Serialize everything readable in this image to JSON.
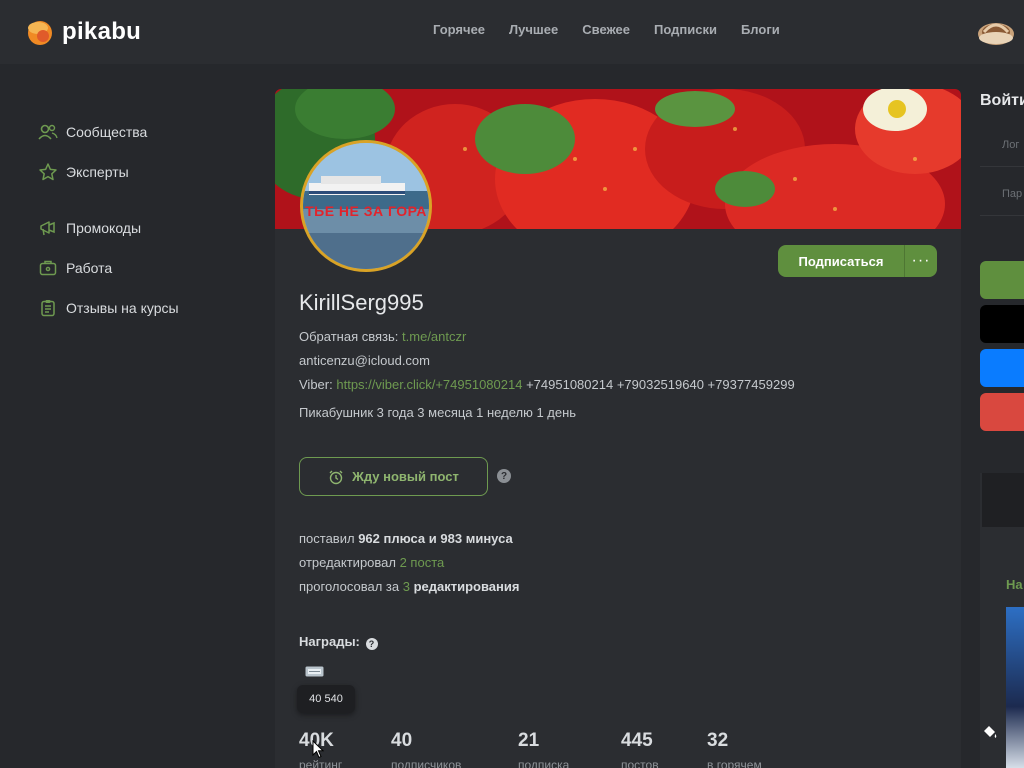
{
  "header": {
    "logo_text": "pikabu",
    "nav": [
      "Горячее",
      "Лучшее",
      "Свежее",
      "Подписки",
      "Блоги"
    ]
  },
  "sidebar": {
    "items": [
      {
        "label": "Сообщества",
        "icon": "people-icon"
      },
      {
        "label": "Эксперты",
        "icon": "star-icon"
      },
      {
        "label": "Промокоды",
        "icon": "megaphone-icon"
      },
      {
        "label": "Работа",
        "icon": "briefcase-icon"
      },
      {
        "label": "Отзывы на курсы",
        "icon": "clipboard-icon"
      }
    ]
  },
  "profile": {
    "avatar_caption": "ТЬЕ НЕ ЗА ГОРА",
    "subscribe_label": "Подписаться",
    "more_label": "···",
    "username": "KirillSerg995",
    "feedback_prefix": "Обратная связь:",
    "feedback_link": "t.me/antczr",
    "email": "anticenzu@icloud.com",
    "viber_prefix": "Viber:",
    "viber_link": "https://viber.click/+74951080214",
    "viber_rest": " +74951080214 +79032519640 +79377459299",
    "tenure": "Пикабушник 3 года 3 месяца 1 неделю 1 день",
    "wait_button": "Жду новый пост",
    "help": "?"
  },
  "activity": {
    "line1_a": "поставил ",
    "pluses": "962",
    "line1_b": " плюса и ",
    "minuses": "983",
    "line1_c": " минуса",
    "line2_a": "отредактировал ",
    "edits": "2 поста",
    "line3_a": "проголосовал за ",
    "votes": "3",
    "line3_b": " редактирования"
  },
  "awards": {
    "label": "Награды:",
    "tooltip": "40 540"
  },
  "stats": [
    {
      "value": "40K",
      "label": "рейтинг"
    },
    {
      "value": "40",
      "label": "подписчиков"
    },
    {
      "value": "21",
      "label": "подписка"
    },
    {
      "value": "445",
      "label": "постов"
    },
    {
      "value": "32",
      "label": "в горячем"
    }
  ],
  "right": {
    "title": "Войти",
    "login_placeholder": "Лог",
    "password_placeholder": "Пар",
    "buttons_colors": [
      "#5f8f3e",
      "#000000",
      "#0a7cff",
      "#d9483f"
    ],
    "promo_text": "На"
  },
  "colors": {
    "accent": "#5f8f3e",
    "link": "#6e9a50",
    "minus": "#e0524b",
    "avatar_ring": "#d9a326"
  }
}
